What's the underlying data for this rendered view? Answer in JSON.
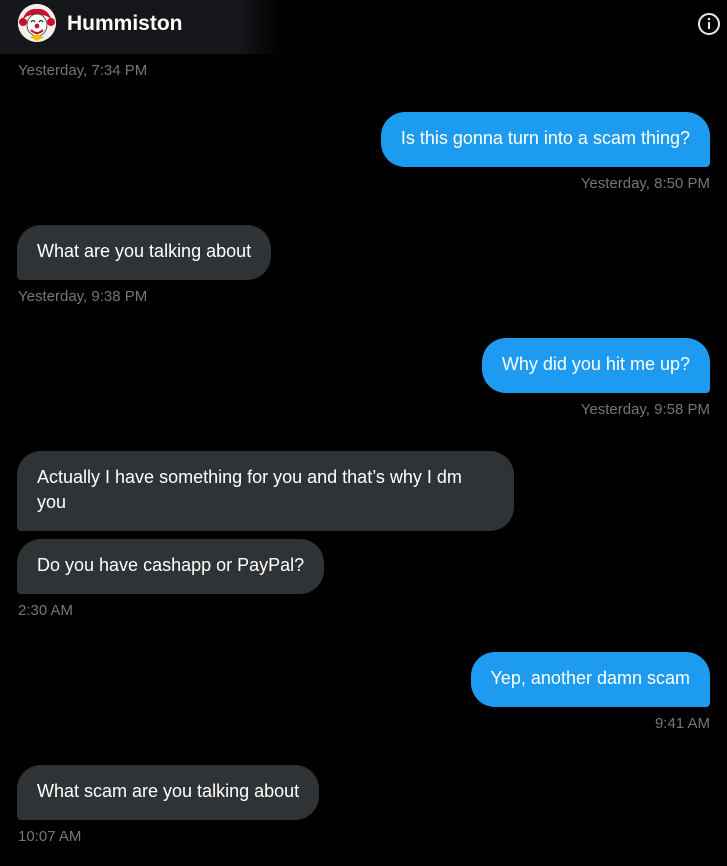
{
  "header": {
    "contact_name": "Hummiston",
    "avatar_icon": "clown-avatar-icon",
    "info_icon": "info-icon"
  },
  "colors": {
    "background": "#000000",
    "incoming_bubble": "#2f3336",
    "outgoing_bubble": "#1d9bf0",
    "timestamp": "#71767b"
  },
  "conversation": {
    "top_timestamp": "Yesterday, 7:34 PM",
    "messages": [
      {
        "direction": "outgoing",
        "text": "Is this gonna turn into a scam thing?",
        "timestamp": "Yesterday, 8:50 PM"
      },
      {
        "direction": "incoming",
        "text": "What are you talking about",
        "timestamp": "Yesterday, 9:38 PM"
      },
      {
        "direction": "outgoing",
        "text": "Why did you hit me up?",
        "timestamp": "Yesterday, 9:58 PM"
      },
      {
        "direction": "incoming",
        "text": "Actually I have something for you and that’s why I dm you",
        "timestamp": ""
      },
      {
        "direction": "incoming",
        "text": "Do you have cashapp or PayPal?",
        "timestamp": "2:30 AM"
      },
      {
        "direction": "outgoing",
        "text": "Yep, another damn scam",
        "timestamp": "9:41 AM"
      },
      {
        "direction": "incoming",
        "text": "What scam are you talking about",
        "timestamp": "10:07 AM"
      }
    ]
  }
}
